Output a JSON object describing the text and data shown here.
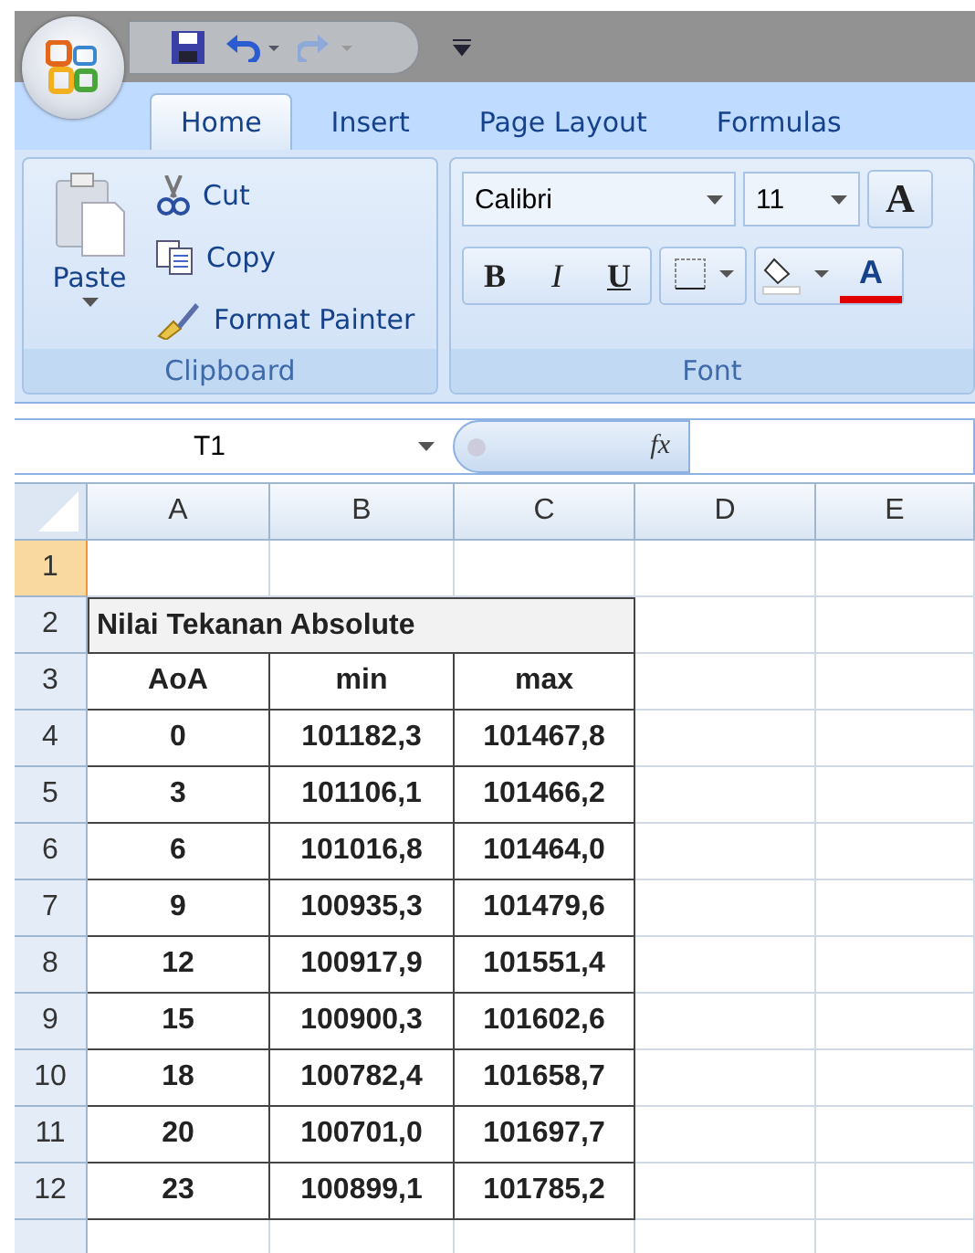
{
  "tabs": [
    {
      "label": "Home",
      "selected": true
    },
    {
      "label": "Insert",
      "selected": false
    },
    {
      "label": "Page Layout",
      "selected": false
    },
    {
      "label": "Formulas",
      "selected": false
    }
  ],
  "clipboard": {
    "paste": "Paste",
    "items": [
      {
        "kind": "cut",
        "label": "Cut"
      },
      {
        "kind": "copy",
        "label": "Copy"
      },
      {
        "kind": "painter",
        "label": "Format Painter"
      }
    ],
    "group_label": "Clipboard"
  },
  "font": {
    "name": "Calibri",
    "size": "11",
    "grow": "A",
    "bold": "B",
    "italic": "I",
    "underline": "U",
    "color_button": "A",
    "group_label": "Font"
  },
  "formula_bar": {
    "name_box": "T1",
    "fx": "fx"
  },
  "columns": [
    "A",
    "B",
    "C",
    "D",
    "E"
  ],
  "rows": [
    {
      "number": "1",
      "selected": true,
      "kind": "empty"
    },
    {
      "number": "2",
      "selected": false,
      "kind": "title",
      "title": "Nilai Tekanan Absolute"
    },
    {
      "number": "3",
      "selected": false,
      "kind": "data",
      "cells": [
        "AoA",
        "min",
        "max"
      ]
    },
    {
      "number": "4",
      "selected": false,
      "kind": "data",
      "cells": [
        "0",
        "101182,3",
        "101467,8"
      ]
    },
    {
      "number": "5",
      "selected": false,
      "kind": "data",
      "cells": [
        "3",
        "101106,1",
        "101466,2"
      ]
    },
    {
      "number": "6",
      "selected": false,
      "kind": "data",
      "cells": [
        "6",
        "101016,8",
        "101464,0"
      ]
    },
    {
      "number": "7",
      "selected": false,
      "kind": "data",
      "cells": [
        "9",
        "100935,3",
        "101479,6"
      ]
    },
    {
      "number": "8",
      "selected": false,
      "kind": "data",
      "cells": [
        "12",
        "100917,9",
        "101551,4"
      ]
    },
    {
      "number": "9",
      "selected": false,
      "kind": "data",
      "cells": [
        "15",
        "100900,3",
        "101602,6"
      ]
    },
    {
      "number": "10",
      "selected": false,
      "kind": "data",
      "cells": [
        "18",
        "100782,4",
        "101658,7"
      ]
    },
    {
      "number": "11",
      "selected": false,
      "kind": "data",
      "cells": [
        "20",
        "100701,0",
        "101697,7"
      ]
    },
    {
      "number": "12",
      "selected": false,
      "kind": "data",
      "cells": [
        "23",
        "100899,1",
        "101785,2"
      ]
    }
  ]
}
